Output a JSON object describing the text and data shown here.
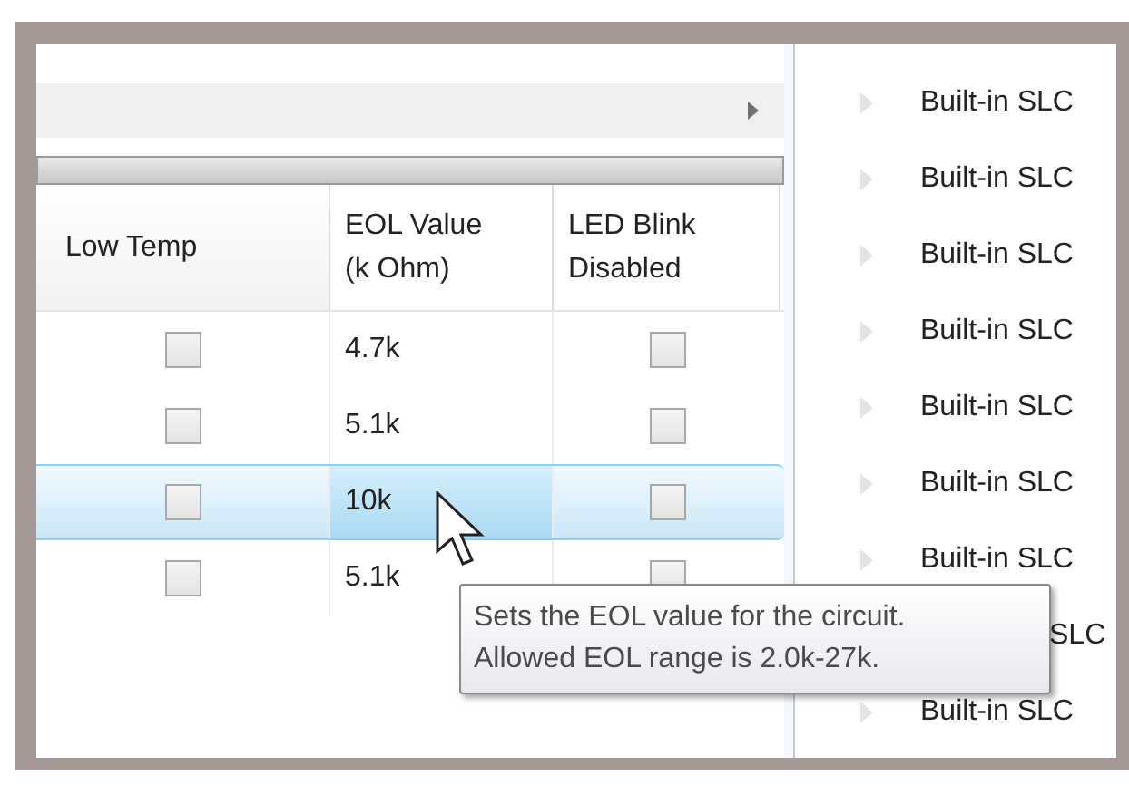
{
  "grid": {
    "columns": [
      "Low Temp",
      "EOL Value\n(k Ohm)",
      "LED Blink\nDisabled"
    ],
    "rows": [
      {
        "low_temp": false,
        "eol": "4.7k",
        "led_blink_disabled": false,
        "selected": false
      },
      {
        "low_temp": false,
        "eol": "5.1k",
        "led_blink_disabled": false,
        "selected": false
      },
      {
        "low_temp": false,
        "eol": "10k",
        "led_blink_disabled": false,
        "selected": true
      },
      {
        "low_temp": false,
        "eol": "5.1k",
        "led_blink_disabled": false,
        "selected": false
      }
    ]
  },
  "tooltip": {
    "lines": [
      "Sets the EOL value for the circuit.",
      "Allowed EOL range is 2.0k-27k."
    ]
  },
  "tree": {
    "items": [
      {
        "label": "Built-in SLC",
        "kind": "full"
      },
      {
        "label": "Built-in SLC",
        "kind": "full"
      },
      {
        "label": "Built-in SLC",
        "kind": "full"
      },
      {
        "label": "Built-in SLC",
        "kind": "full"
      },
      {
        "label": "Built-in SLC",
        "kind": "full"
      },
      {
        "label": "Built-in SLC",
        "kind": "full"
      },
      {
        "label": "Built-in SLC",
        "kind": "full"
      },
      {
        "label": "SLC",
        "kind": "covered"
      },
      {
        "label": "Built-in SLC",
        "kind": "full"
      }
    ]
  }
}
